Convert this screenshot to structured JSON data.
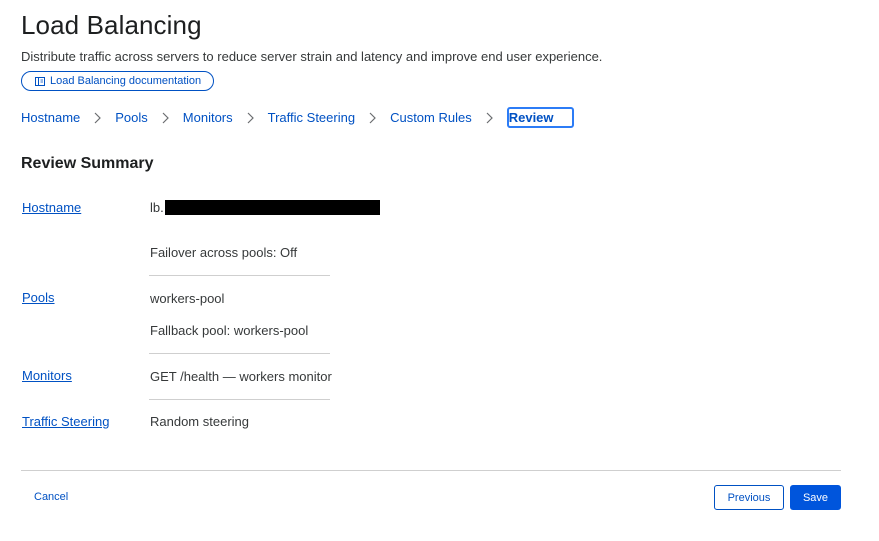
{
  "page": {
    "title": "Load Balancing",
    "subtitle": "Distribute traffic across servers to reduce server strain and latency and improve end user experience.",
    "doc_link": {
      "label": "Load Balancing documentation",
      "icon": "book-icon"
    }
  },
  "steps": [
    {
      "label": "Hostname"
    },
    {
      "label": "Pools"
    },
    {
      "label": "Monitors"
    },
    {
      "label": "Traffic Steering"
    },
    {
      "label": "Custom Rules"
    },
    {
      "label": "Review",
      "current": true
    }
  ],
  "summary": {
    "title": "Review Summary",
    "hostname": {
      "label": "Hostname",
      "value_prefix": "lb.",
      "failover": "Failover across pools: Off"
    },
    "pools": {
      "label": "Pools",
      "pool": "workers-pool",
      "fallback": "Fallback pool: workers-pool"
    },
    "monitors": {
      "label": "Monitors",
      "value": "GET /health — workers monitor"
    },
    "traffic_steering": {
      "label": "Traffic Steering",
      "value": "Random steering"
    }
  },
  "footer": {
    "cancel": "Cancel",
    "previous": "Previous",
    "save": "Save"
  },
  "colors": {
    "link": "#0051c3",
    "primary_button": "#0055dc",
    "focus_ring": "#2c7cf6",
    "divider": "#cfcfcf"
  }
}
